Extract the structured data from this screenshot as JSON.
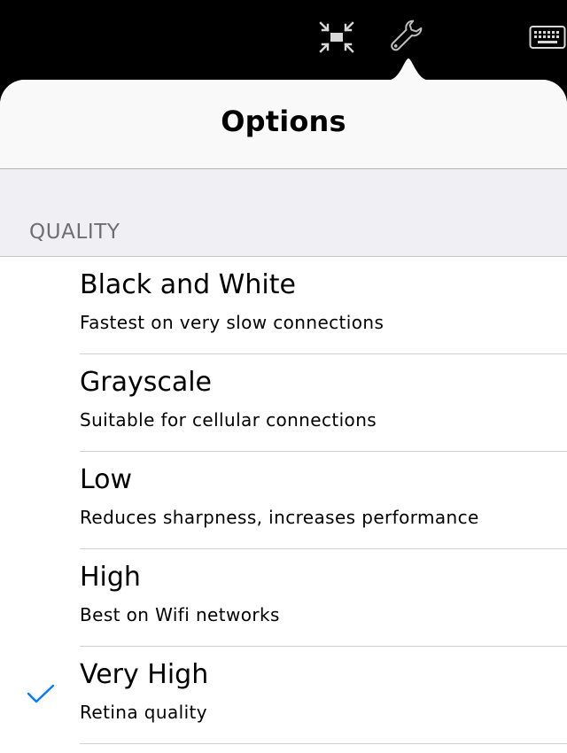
{
  "toolbar": {
    "icons": [
      "exit-fullscreen-icon",
      "wrench-icon",
      "keyboard-icon"
    ]
  },
  "options": {
    "title": "Options",
    "section_header": "QUALITY",
    "items": [
      {
        "title": "Black and White",
        "subtitle": "Fastest on very slow connections",
        "selected": false
      },
      {
        "title": "Grayscale",
        "subtitle": "Suitable for cellular connections",
        "selected": false
      },
      {
        "title": "Low",
        "subtitle": "Reduces sharpness, increases performance",
        "selected": false
      },
      {
        "title": "High",
        "subtitle": "Best on Wifi networks",
        "selected": false
      },
      {
        "title": "Very High",
        "subtitle": "Retina quality",
        "selected": true
      }
    ]
  },
  "colors": {
    "accent": "#007aff",
    "toolbar_bg": "#000000",
    "header_bg": "#f9f9f9",
    "group_bg": "#efeff4",
    "section_header_text": "#6d6d72"
  }
}
